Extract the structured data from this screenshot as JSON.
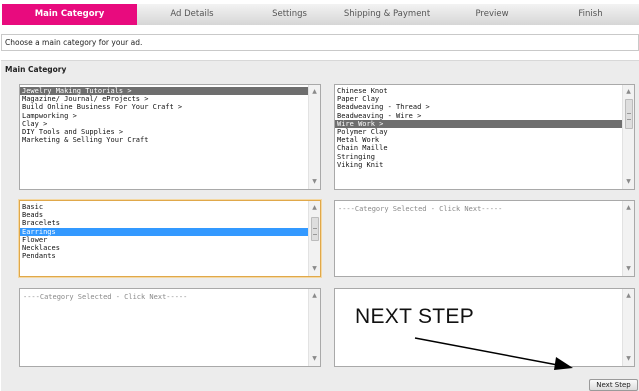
{
  "tabs": [
    {
      "label": "Main Category",
      "active": true
    },
    {
      "label": "Ad Details",
      "active": false
    },
    {
      "label": "Settings",
      "active": false
    },
    {
      "label": "Shipping & Payment",
      "active": false
    },
    {
      "label": "Preview",
      "active": false
    },
    {
      "label": "Finish",
      "active": false
    }
  ],
  "instruction": "Choose a main category for your ad.",
  "panel": {
    "title": "Main Category"
  },
  "list_top_left": {
    "items": [
      "Jewelry Making Tutorials >",
      "Magazine/ Journal/ eProjects >",
      "Build Online Business For Your Craft >",
      "Lampworking >",
      "Clay >",
      "DIY Tools and Supplies >",
      "Marketing & Selling Your Craft"
    ],
    "selected": "Jewelry Making Tutorials >"
  },
  "list_top_right": {
    "items": [
      "Chinese Knot",
      "Paper Clay",
      "Beadweaving - Thread >",
      "Beadweaving - Wire >",
      "Wire Work >",
      "Polymer Clay",
      "Metal Work",
      "Chain Maille",
      "Stringing",
      "Viking Knit"
    ],
    "selected": "Wire Work >"
  },
  "list_mid_left": {
    "items": [
      "Basic",
      "Beads",
      "Bracelets",
      "Earrings",
      "Flower",
      "Necklaces",
      "Pendants"
    ],
    "selected": "Earrings"
  },
  "list_mid_right": {
    "placeholder": "----Category Selected - Click Next-----"
  },
  "list_bottom_left": {
    "placeholder": "----Category Selected - Click Next-----"
  },
  "list_bottom_right": {
    "placeholder": ""
  },
  "next_step_button": "Next Step",
  "annotation": {
    "text": "NEXT STEP"
  },
  "colors": {
    "active_tab": "#e80b7e",
    "selection_grey": "#6e6e6e",
    "selection_blue": "#3399ff",
    "panel_bg": "#ececec"
  },
  "icons": {
    "scroll_up": "triangle-up-icon",
    "scroll_down": "triangle-down-icon"
  }
}
